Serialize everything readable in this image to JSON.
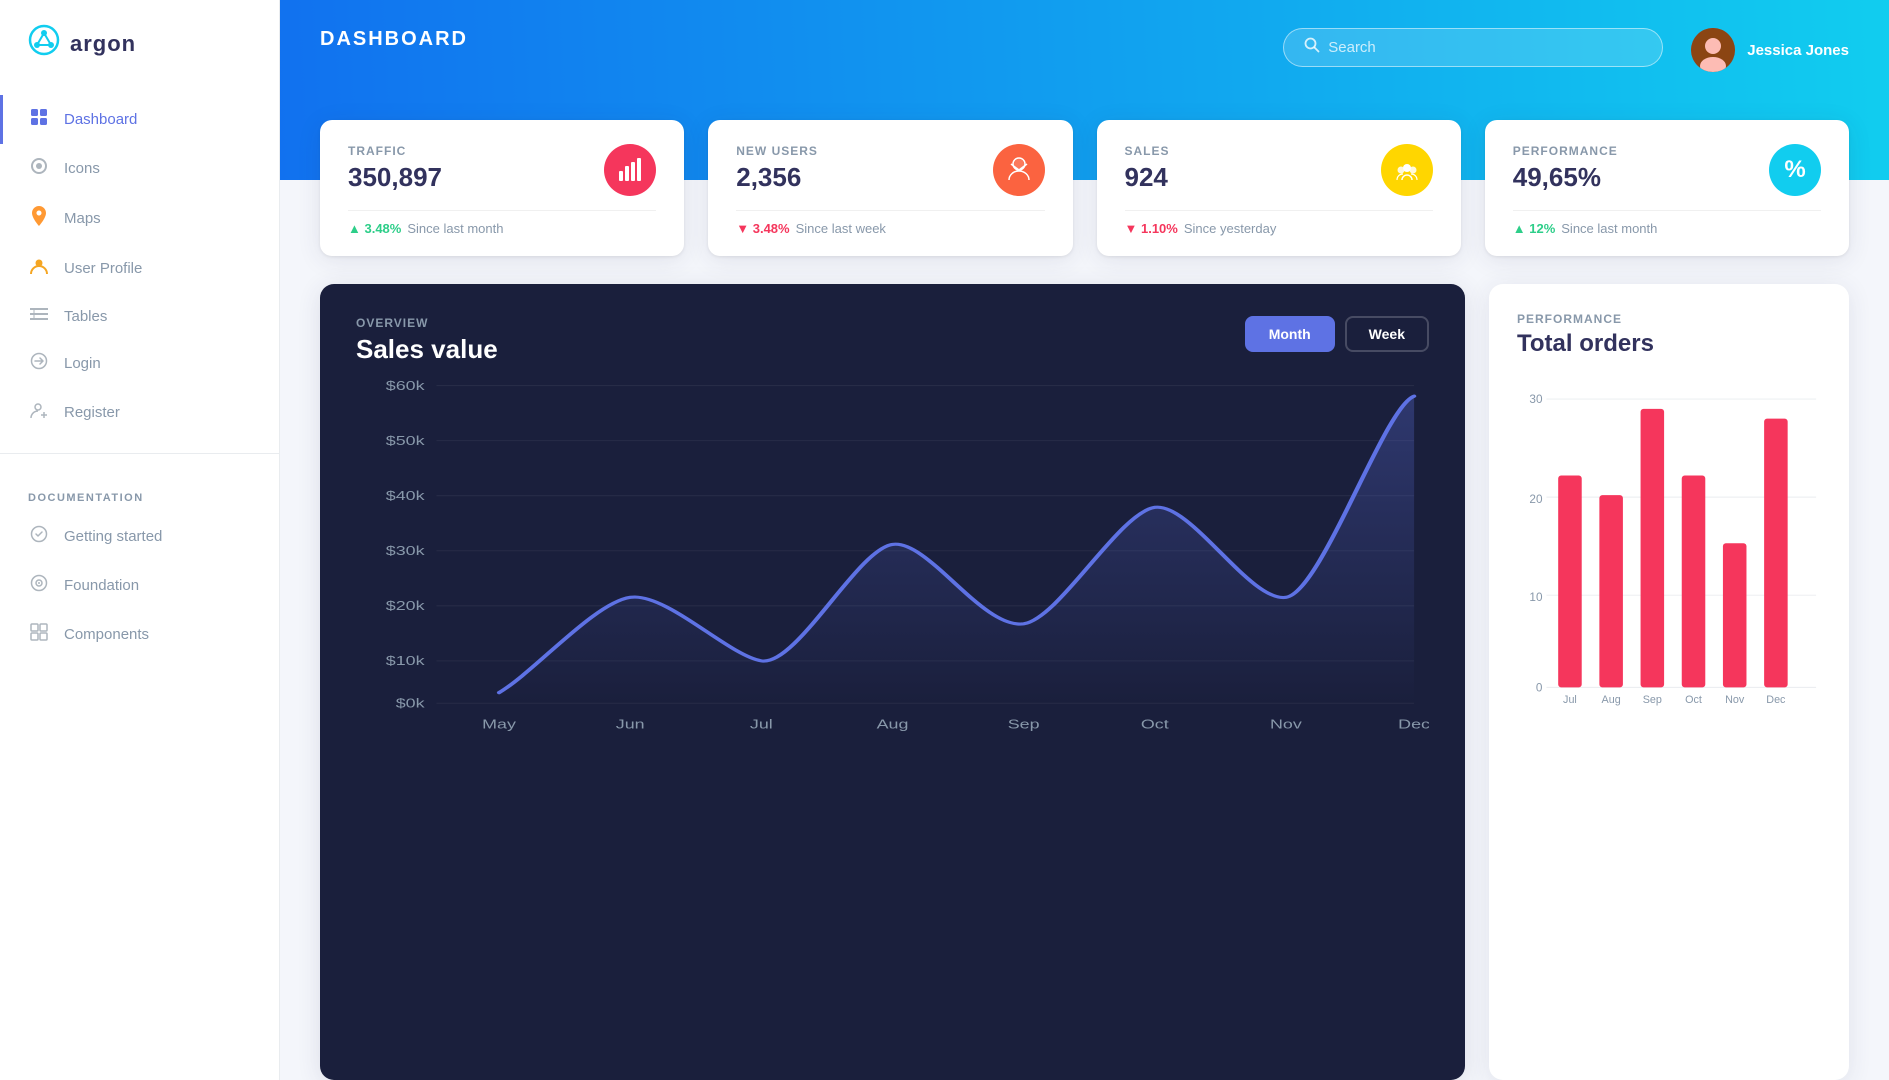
{
  "sidebar": {
    "logo_text": "argon",
    "nav_items": [
      {
        "id": "dashboard",
        "label": "Dashboard",
        "icon": "⬛",
        "active": true
      },
      {
        "id": "icons",
        "label": "Icons",
        "icon": "🔷",
        "active": false
      },
      {
        "id": "maps",
        "label": "Maps",
        "icon": "📍",
        "active": false
      },
      {
        "id": "user-profile",
        "label": "User Profile",
        "icon": "👤",
        "active": false
      },
      {
        "id": "tables",
        "label": "Tables",
        "icon": "☰",
        "active": false
      },
      {
        "id": "login",
        "label": "Login",
        "icon": "🔗",
        "active": false
      },
      {
        "id": "register",
        "label": "Register",
        "icon": "👤",
        "active": false
      }
    ],
    "doc_label": "DOCUMENTATION",
    "doc_items": [
      {
        "id": "getting-started",
        "label": "Getting started",
        "icon": "🚀"
      },
      {
        "id": "foundation",
        "label": "Foundation",
        "icon": "🔮"
      },
      {
        "id": "components",
        "label": "Components",
        "icon": "⊞"
      }
    ]
  },
  "header": {
    "title": "DASHBOARD",
    "search_placeholder": "Search",
    "user_name": "Jessica Jones"
  },
  "stats": [
    {
      "id": "traffic",
      "label": "TRAFFIC",
      "value": "350,897",
      "icon_color": "#f5365c",
      "icon": "📊",
      "change": "3.48%",
      "change_direction": "up",
      "change_label": "Since last month"
    },
    {
      "id": "new-users",
      "label": "NEW USERS",
      "value": "2,356",
      "icon_color": "#fb6340",
      "icon": "🥧",
      "change": "3.48%",
      "change_direction": "down",
      "change_label": "Since last week"
    },
    {
      "id": "sales",
      "label": "SALES",
      "value": "924",
      "icon_color": "#ffd600",
      "icon": "👥",
      "change": "1.10%",
      "change_direction": "down",
      "change_label": "Since yesterday"
    },
    {
      "id": "performance",
      "label": "PERFORMANCE",
      "value": "49,65%",
      "icon_color": "#11cdef",
      "icon": "%",
      "change": "12%",
      "change_direction": "up",
      "change_label": "Since last month"
    }
  ],
  "overview_chart": {
    "label": "OVERVIEW",
    "title": "Sales value",
    "btn_month": "Month",
    "btn_week": "Week",
    "active_btn": "month",
    "y_labels": [
      "$60k",
      "$50k",
      "$40k",
      "$30k",
      "$20k",
      "$10k",
      "$0k"
    ],
    "x_labels": [
      "May",
      "Jun",
      "Jul",
      "Aug",
      "Sep",
      "Oct",
      "Nov",
      "Dec"
    ],
    "data_points": [
      {
        "month": "May",
        "value": 2000
      },
      {
        "month": "Jun",
        "value": 20000
      },
      {
        "month": "Jul",
        "value": 8000
      },
      {
        "month": "Aug",
        "value": 30000
      },
      {
        "month": "Sep",
        "value": 15000
      },
      {
        "month": "Oct",
        "value": 37000
      },
      {
        "month": "Nov",
        "value": 20000
      },
      {
        "month": "Dec",
        "value": 58000
      }
    ]
  },
  "performance_chart": {
    "label": "PERFORMANCE",
    "title": "Total orders",
    "y_labels": [
      "30",
      "20",
      "10",
      "0"
    ],
    "x_labels": [
      "Jul",
      "Aug",
      "Sep",
      "Oct",
      "Nov",
      "Dec"
    ],
    "bars": [
      {
        "month": "Jul",
        "value": 22
      },
      {
        "month": "Aug",
        "value": 20
      },
      {
        "month": "Sep",
        "value": 29
      },
      {
        "month": "Oct",
        "value": 22
      },
      {
        "month": "Nov",
        "value": 15
      },
      {
        "month": "Dec",
        "value": 28
      }
    ],
    "bar_color": "#f5365c",
    "max_value": 30
  }
}
